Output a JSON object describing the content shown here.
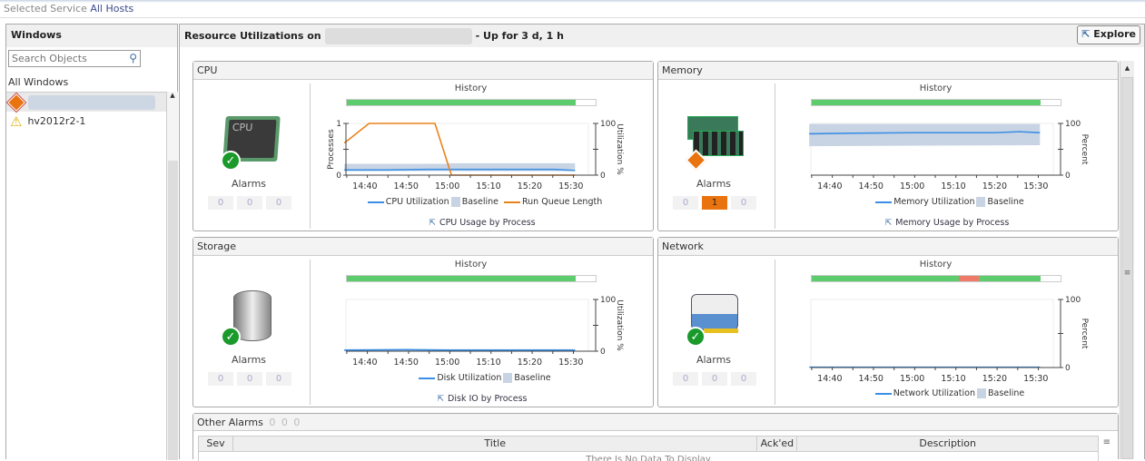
{
  "topbar": {
    "label": "Selected Service",
    "value": "All Hosts"
  },
  "sidebar": {
    "title": "Windows",
    "search_placeholder": "Search Objects",
    "all_label": "All Windows",
    "items": [
      {
        "label": "",
        "status": "warning-orange",
        "selected": true
      },
      {
        "label": "hv2012r2-1",
        "status": "warning-yellow",
        "selected": false
      }
    ]
  },
  "main": {
    "title_prefix": "Resource Utilizations on",
    "title_suffix": "- Up for 3 d, 1 h",
    "explore_label": "Explore"
  },
  "colors": {
    "history_ok": "#5ccc6c",
    "history_alert": "#f07a6a",
    "utilization": "#3a8ee6",
    "baseline": "#c8d4e3",
    "run_queue": "#e8821a",
    "alarm_active": "#e8730f"
  },
  "panels": [
    {
      "id": "cpu",
      "title": "CPU",
      "icon": "cpu-icon",
      "icon_text": "CPU",
      "status": "ok",
      "alarms_label": "Alarms",
      "alarms": [
        0,
        0,
        0
      ],
      "active_alarm": -1,
      "history_label": "History",
      "history": [
        {
          "state": "ok",
          "fraction": 0.92
        }
      ],
      "link": "CPU Usage by Process"
    },
    {
      "id": "memory",
      "title": "Memory",
      "icon": "memory-icon",
      "status": "warning",
      "alarms_label": "Alarms",
      "alarms": [
        0,
        1,
        0
      ],
      "active_alarm": 1,
      "history_label": "History",
      "history": [
        {
          "state": "ok",
          "fraction": 0.92
        }
      ],
      "link": "Memory Usage by Process"
    },
    {
      "id": "storage",
      "title": "Storage",
      "icon": "disk-icon",
      "status": "ok",
      "alarms_label": "Alarms",
      "alarms": [
        0,
        0,
        0
      ],
      "active_alarm": -1,
      "history_label": "History",
      "history": [
        {
          "state": "ok",
          "fraction": 0.92
        }
      ],
      "link": "Disk IO by Process"
    },
    {
      "id": "network",
      "title": "Network",
      "icon": "network-icon",
      "status": "ok",
      "alarms_label": "Alarms",
      "alarms": [
        0,
        0,
        0
      ],
      "active_alarm": -1,
      "history_label": "History",
      "history": [
        {
          "state": "ok",
          "fraction": 0.59
        },
        {
          "state": "alert",
          "fraction": 0.08
        },
        {
          "state": "ok",
          "fraction": 0.25
        }
      ],
      "link": ""
    }
  ],
  "chart_data": [
    {
      "type": "line",
      "panel": "cpu",
      "xticks": [
        "14:40",
        "14:50",
        "15:00",
        "15:10",
        "15:20",
        "15:30"
      ],
      "xlim": [
        "14:35",
        "15:36"
      ],
      "ylabel_left": "Processes",
      "ylim_left": [
        0,
        1
      ],
      "yticks_left": [
        "0",
        "1"
      ],
      "ylabel_right": "Utilization %",
      "ylim_right": [
        0,
        100
      ],
      "yticks_right": [
        "0",
        "100"
      ],
      "series": [
        {
          "name": "CPU Utilization",
          "axis": "right",
          "kind": "line",
          "color": "#3a8ee6",
          "points": [
            [
              "14:35",
              10
            ],
            [
              "14:45",
              10
            ],
            [
              "14:55",
              11
            ],
            [
              "15:05",
              11
            ],
            [
              "15:15",
              11
            ],
            [
              "15:26",
              11
            ],
            [
              "15:31",
              9
            ]
          ]
        },
        {
          "name": "Baseline",
          "axis": "right",
          "kind": "band",
          "color": "#c8d4e3",
          "points": [
            [
              "14:35",
              8,
              22
            ],
            [
              "15:00",
              8,
              22
            ],
            [
              "15:00",
              8,
              23
            ],
            [
              "15:31",
              8,
              23
            ]
          ]
        },
        {
          "name": "Run Queue Length",
          "axis": "left",
          "kind": "line",
          "color": "#e8821a",
          "points": [
            [
              "14:35",
              0.62
            ],
            [
              "14:41",
              1
            ],
            [
              "14:57",
              1
            ],
            [
              "15:01",
              0
            ],
            [
              "15:31",
              0
            ]
          ]
        }
      ]
    },
    {
      "type": "line",
      "panel": "memory",
      "xticks": [
        "14:40",
        "14:50",
        "15:00",
        "15:10",
        "15:20",
        "15:30"
      ],
      "xlim": [
        "14:35",
        "15:36"
      ],
      "ylabel_right": "Percent",
      "ylim_right": [
        0,
        100
      ],
      "yticks_right": [
        "0",
        "100"
      ],
      "series": [
        {
          "name": "Memory Utilization",
          "axis": "right",
          "kind": "line",
          "color": "#3a8ee6",
          "points": [
            [
              "14:35",
              80
            ],
            [
              "14:45",
              81
            ],
            [
              "15:00",
              82
            ],
            [
              "15:20",
              82
            ],
            [
              "15:26",
              84
            ],
            [
              "15:31",
              82
            ]
          ]
        },
        {
          "name": "Baseline",
          "axis": "right",
          "kind": "band",
          "color": "#c8d4e3",
          "points": [
            [
              "14:35",
              56,
              99
            ],
            [
              "15:31",
              58,
              99
            ]
          ]
        }
      ]
    },
    {
      "type": "line",
      "panel": "storage",
      "xticks": [
        "14:40",
        "14:50",
        "15:00",
        "15:10",
        "15:20",
        "15:30"
      ],
      "xlim": [
        "14:35",
        "15:36"
      ],
      "ylabel_right": "Utilization %",
      "ylim_right": [
        0,
        100
      ],
      "yticks_right": [
        "0",
        "100"
      ],
      "series": [
        {
          "name": "Disk Utilization",
          "axis": "right",
          "kind": "line",
          "color": "#3a8ee6",
          "points": [
            [
              "14:35",
              2
            ],
            [
              "14:50",
              3
            ],
            [
              "15:00",
              2
            ],
            [
              "15:31",
              2
            ]
          ]
        },
        {
          "name": "Baseline",
          "axis": "right",
          "kind": "band",
          "color": "#c8d4e3",
          "points": [
            [
              "14:35",
              0,
              4
            ],
            [
              "15:31",
              0,
              4
            ]
          ]
        }
      ]
    },
    {
      "type": "line",
      "panel": "network",
      "xticks": [
        "14:40",
        "14:50",
        "15:00",
        "15:10",
        "15:20",
        "15:30"
      ],
      "xlim": [
        "14:35",
        "15:36"
      ],
      "ylabel_right": "Percent",
      "ylim_right": [
        0,
        100
      ],
      "yticks_right": [
        "0",
        "100"
      ],
      "series": [
        {
          "name": "Network Utilization",
          "axis": "right",
          "kind": "line",
          "color": "#3a8ee6",
          "points": [
            [
              "14:35",
              0.5
            ],
            [
              "15:31",
              0.5
            ]
          ]
        },
        {
          "name": "Baseline",
          "axis": "right",
          "kind": "band",
          "color": "#c8d4e3",
          "points": [
            [
              "14:35",
              0,
              1
            ],
            [
              "15:31",
              0,
              1
            ]
          ]
        }
      ]
    }
  ],
  "other_alarms": {
    "title": "Other Alarms",
    "counts": [
      0,
      0,
      0
    ],
    "columns": [
      "Sev",
      "Title",
      "Ack'ed",
      "Description"
    ],
    "empty_text": "There Is No Data To Display"
  }
}
